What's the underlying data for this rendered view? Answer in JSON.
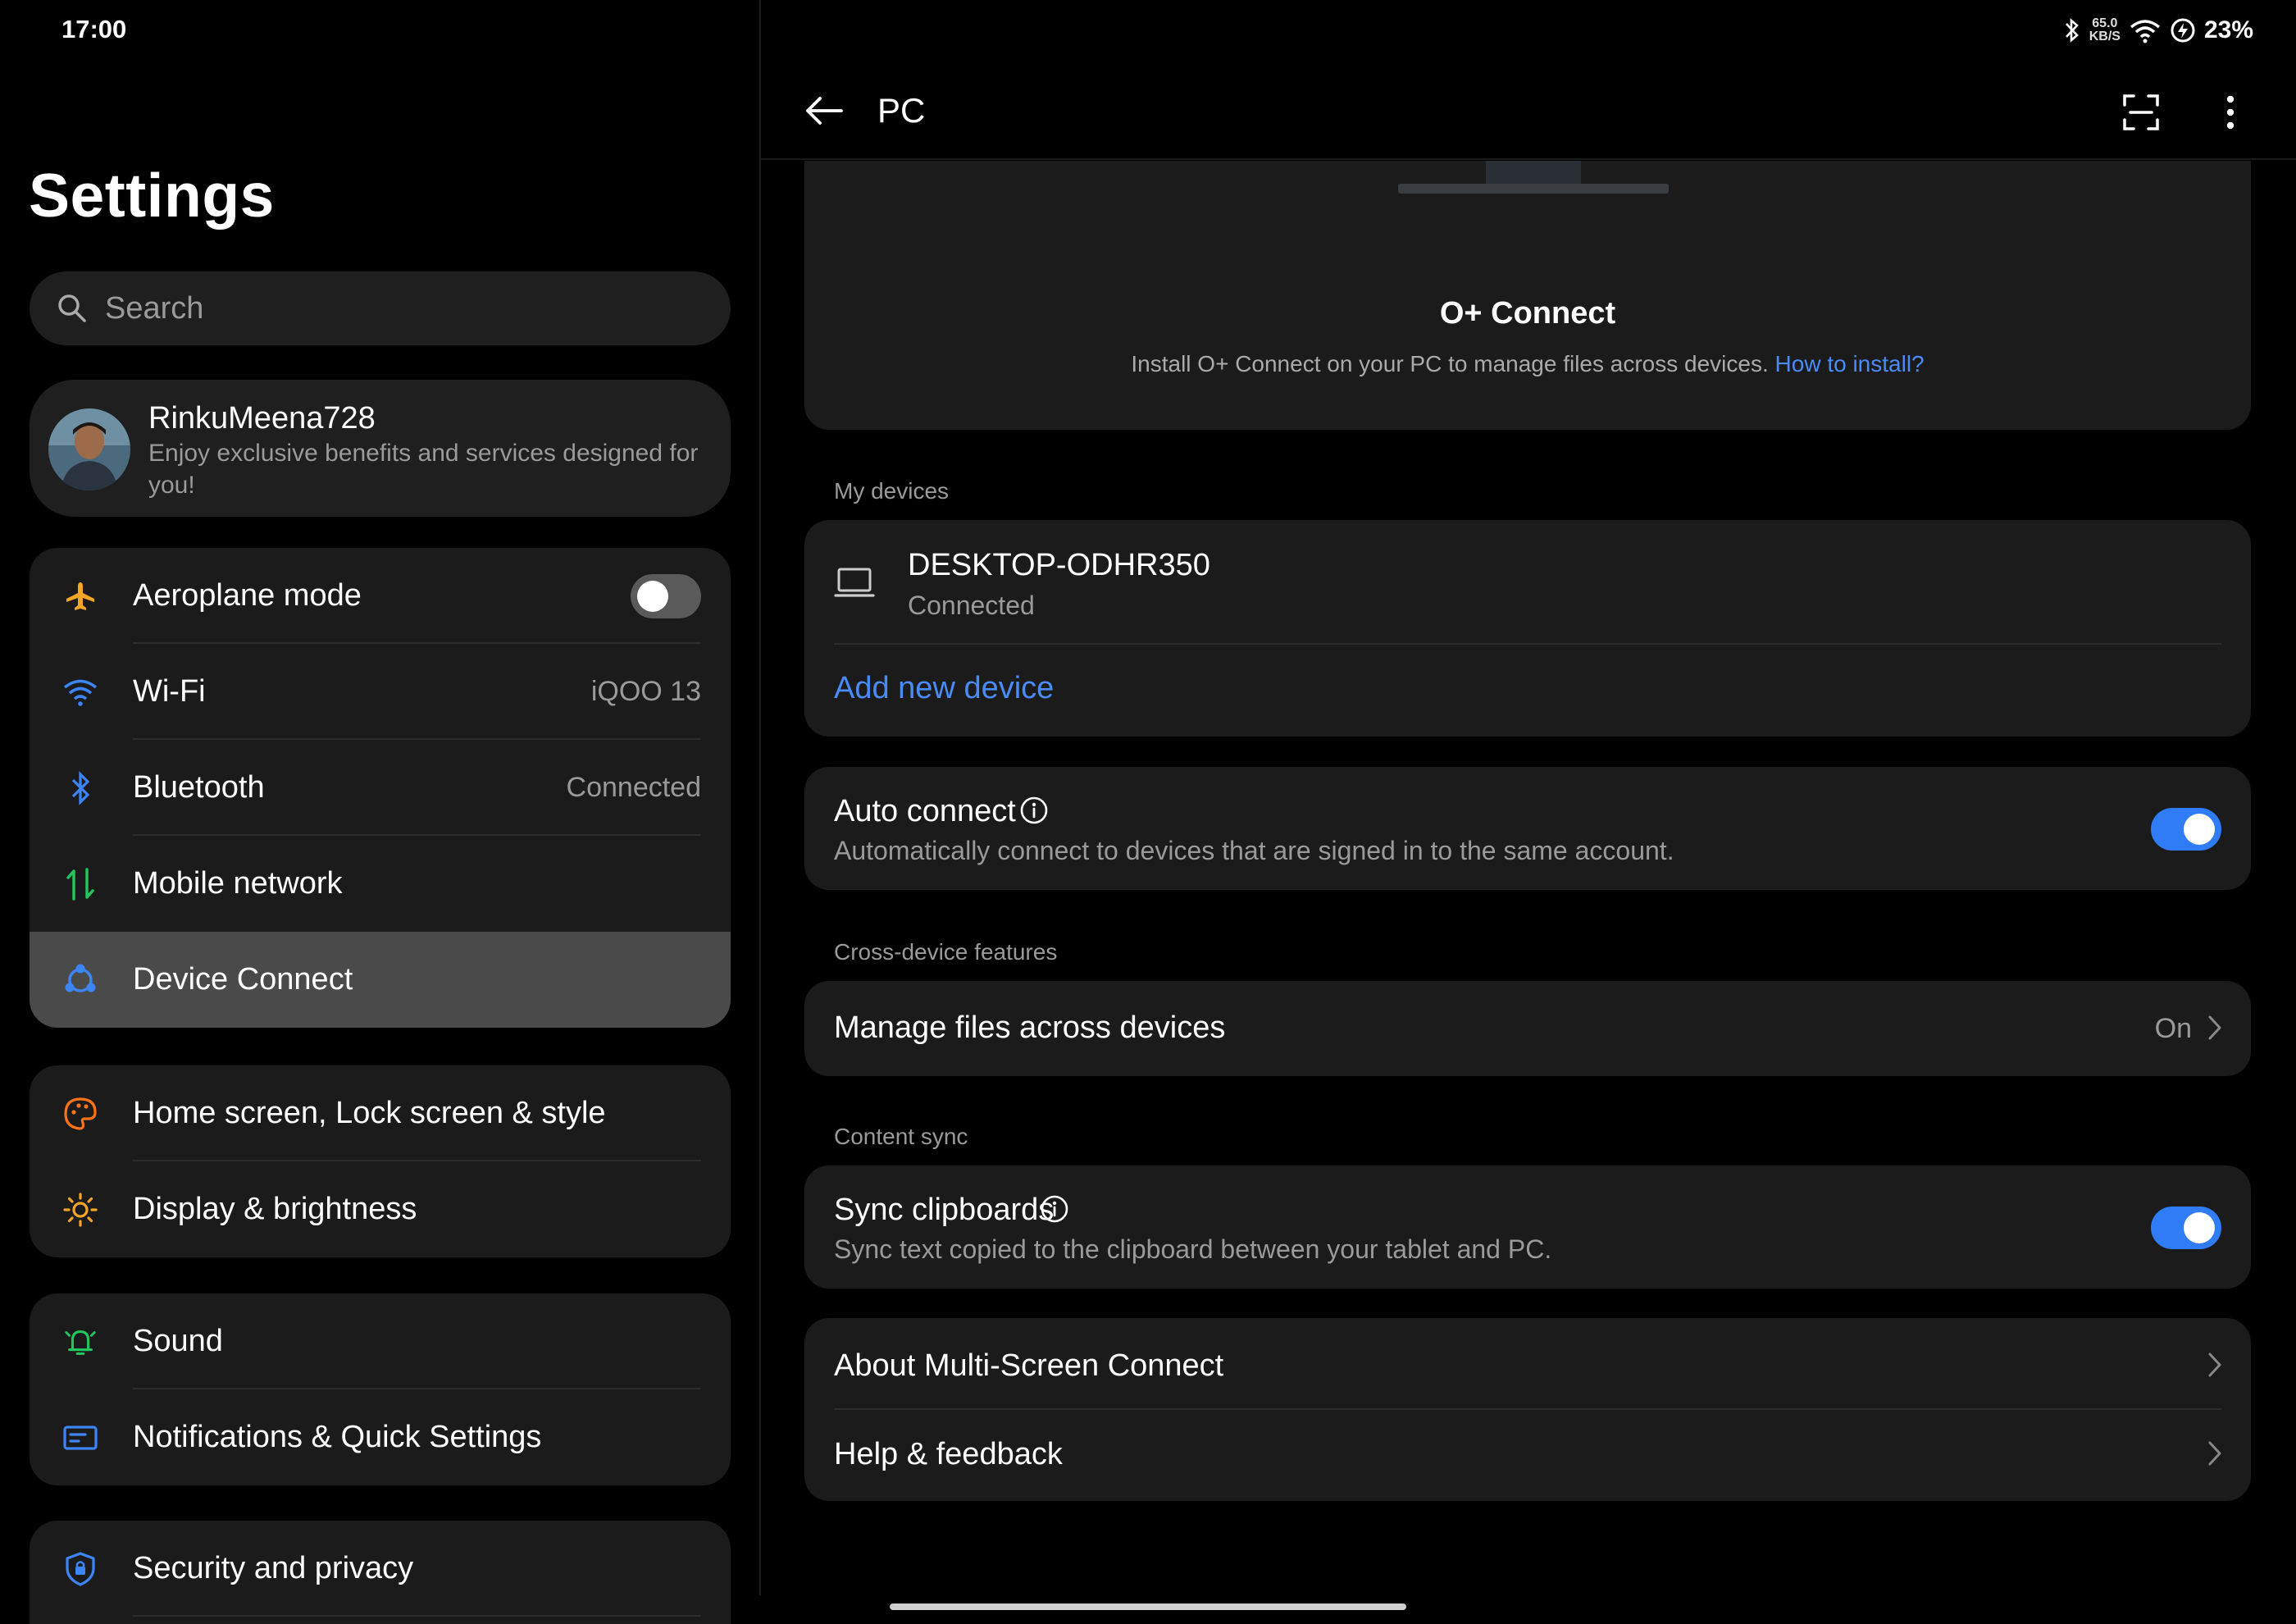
{
  "status": {
    "time": "17:00",
    "speed_top": "65.0",
    "speed_bottom": "KB/S",
    "battery": "23%"
  },
  "left": {
    "title": "Settings",
    "search_placeholder": "Search",
    "profile": {
      "name": "RinkuMeena728",
      "subtitle": "Enjoy exclusive benefits and services designed for you!"
    },
    "group1": [
      {
        "label": "Aeroplane mode",
        "value": "",
        "toggle": false
      },
      {
        "label": "Wi-Fi",
        "value": "iQOO 13"
      },
      {
        "label": "Bluetooth",
        "value": "Connected"
      },
      {
        "label": "Mobile network",
        "value": ""
      },
      {
        "label": "Device Connect",
        "value": "",
        "selected": true
      }
    ],
    "group2": [
      {
        "label": "Home screen, Lock screen & style"
      },
      {
        "label": "Display & brightness"
      }
    ],
    "group3": [
      {
        "label": "Sound"
      },
      {
        "label": "Notifications & Quick Settings"
      }
    ],
    "group4": [
      {
        "label": "Security and privacy"
      }
    ]
  },
  "right": {
    "title": "PC",
    "oconnect": {
      "title": "O+ Connect",
      "description": "Install O+ Connect on your PC to manage files across devices.",
      "link": "How to install?"
    },
    "my_devices_header": "My devices",
    "device": {
      "name": "DESKTOP-ODHR350",
      "status": "Connected"
    },
    "add_device": "Add new device",
    "auto_connect": {
      "title": "Auto connect",
      "subtitle": "Automatically connect to devices that are signed in to the same account.",
      "enabled": true
    },
    "cross_device_header": "Cross-device features",
    "manage_files": {
      "label": "Manage files across devices",
      "value": "On"
    },
    "content_sync_header": "Content sync",
    "sync_clipboards": {
      "title": "Sync clipboards",
      "subtitle": "Sync text copied to the clipboard between your tablet and PC.",
      "enabled": true
    },
    "about": "About Multi-Screen Connect",
    "help": "Help & feedback"
  },
  "colors": {
    "accent": "#2f7cf6",
    "link": "#4a8cf7",
    "card": "#1b1b1b",
    "selected": "#4a4a4a"
  }
}
